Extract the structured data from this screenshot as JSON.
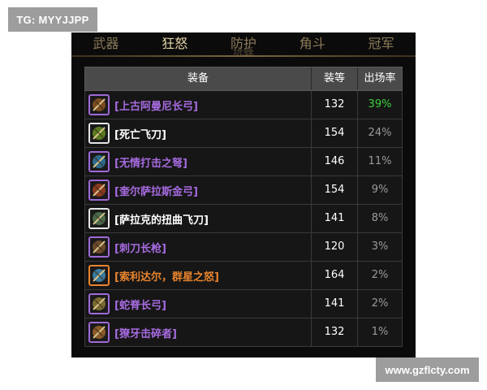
{
  "watermarks": {
    "top_left": "TG: MYYJJPP",
    "bottom_right": "www.gzflcty.com"
  },
  "tabs": [
    {
      "label": "武器",
      "active": false
    },
    {
      "label": "狂怒",
      "active": true
    },
    {
      "label": "防护",
      "active": false,
      "overlay": "玩蜂"
    },
    {
      "label": "角斗",
      "active": false
    },
    {
      "label": "冠军",
      "active": false
    }
  ],
  "table": {
    "headers": {
      "item": "装备",
      "ilvl": "装等",
      "rate": "出场率"
    },
    "rows": [
      {
        "name": "[上古阿曼尼长弓]",
        "ilvl": "132",
        "rate": "39%",
        "quality": "epic",
        "name_color": "#a66be0",
        "rate_color": "#3bd13b",
        "icon": "amani-bow-icon",
        "icon_color": "#a06ad8",
        "art": "#7a4b20"
      },
      {
        "name": "[死亡飞刀]",
        "ilvl": "154",
        "rate": "24%",
        "quality": "common",
        "name_color": "#ffffff",
        "rate_color": "#9a9a9a",
        "icon": "throwing-knife-icon",
        "icon_color": "#e6e6e6",
        "art": "#5a7a20"
      },
      {
        "name": "[无情打击之弩]",
        "ilvl": "146",
        "rate": "11%",
        "quality": "epic",
        "name_color": "#a66be0",
        "rate_color": "#9a9a9a",
        "icon": "crossbow-icon",
        "icon_color": "#a06ad8",
        "art": "#2e6a8a"
      },
      {
        "name": "[奎尔萨拉斯金弓]",
        "ilvl": "154",
        "rate": "9%",
        "quality": "epic",
        "name_color": "#a66be0",
        "rate_color": "#9a9a9a",
        "icon": "golden-bow-icon",
        "icon_color": "#a06ad8",
        "art": "#8a3a20"
      },
      {
        "name": "[萨拉克的扭曲飞刀]",
        "ilvl": "141",
        "rate": "8%",
        "quality": "common",
        "name_color": "#ffffff",
        "rate_color": "#9a9a9a",
        "icon": "twisted-knife-icon",
        "icon_color": "#e6e6e6",
        "art": "#4a6a4a"
      },
      {
        "name": "[刺刀长枪]",
        "ilvl": "120",
        "rate": "3%",
        "quality": "epic",
        "name_color": "#a66be0",
        "rate_color": "#9a9a9a",
        "icon": "bayonet-gun-icon",
        "icon_color": "#a06ad8",
        "art": "#6a4a2a"
      },
      {
        "name": "[索利达尔，群星之怒]",
        "ilvl": "164",
        "rate": "2%",
        "quality": "legendary",
        "name_color": "#e9842e",
        "rate_color": "#9a9a9a",
        "icon": "star-bow-icon",
        "icon_color": "#e9842e",
        "art": "#3a7a9a"
      },
      {
        "name": "[蛇脊长弓]",
        "ilvl": "141",
        "rate": "2%",
        "quality": "epic",
        "name_color": "#a66be0",
        "rate_color": "#9a9a9a",
        "icon": "serpent-bow-icon",
        "icon_color": "#a06ad8",
        "art": "#7a6a30"
      },
      {
        "name": "[獠牙击碎者]",
        "ilvl": "132",
        "rate": "1%",
        "quality": "epic",
        "name_color": "#a66be0",
        "rate_color": "#9a9a9a",
        "icon": "tusk-gun-icon",
        "icon_color": "#a06ad8",
        "art": "#8a5a2a"
      }
    ]
  }
}
